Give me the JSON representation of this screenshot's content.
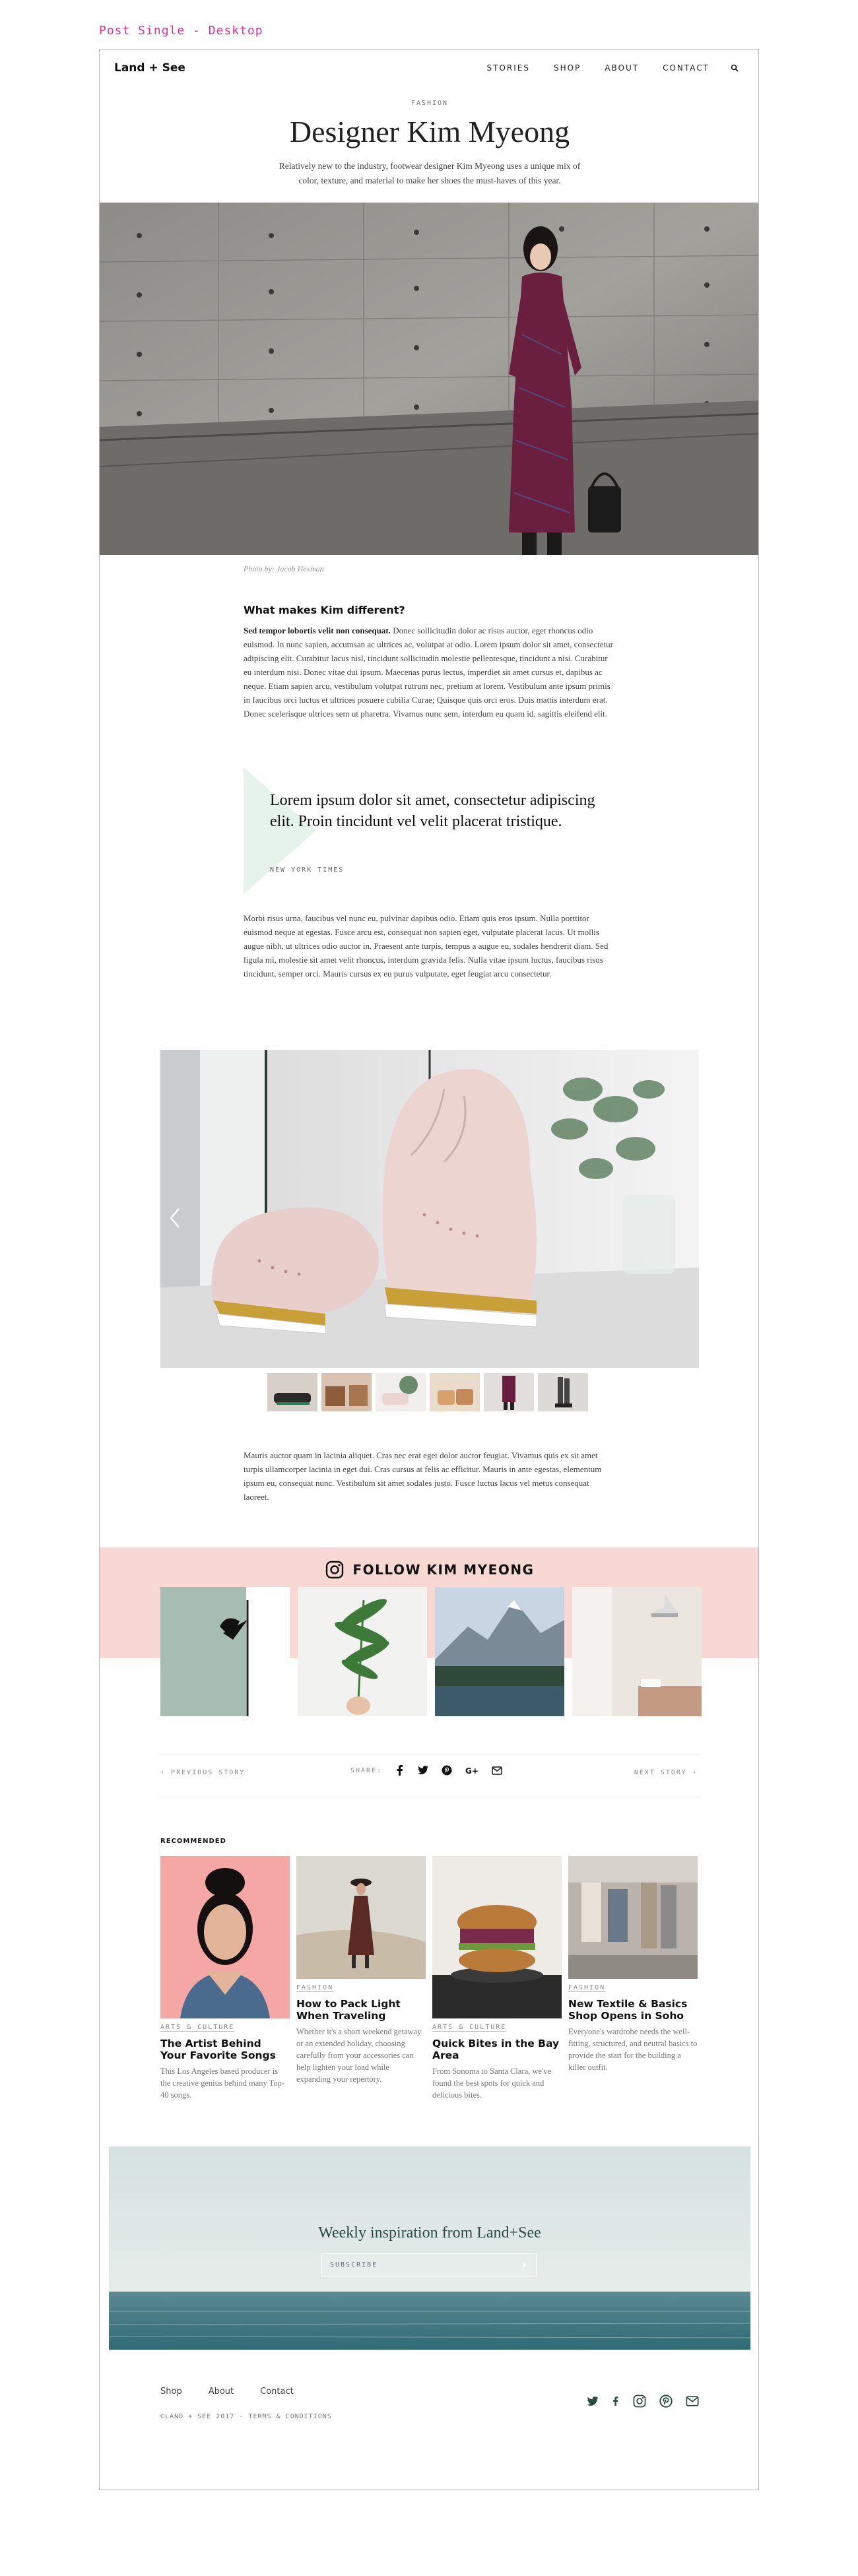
{
  "page_label": "Post Single - Desktop",
  "header": {
    "logo": "Land + See",
    "nav": [
      "STORIES",
      "SHOP",
      "ABOUT",
      "CONTACT"
    ]
  },
  "article": {
    "category": "FASHION",
    "title": "Designer Kim Myeong",
    "subtitle": "Relatively new to the industry, footwear designer Kim Myeong uses a unique mix of color, texture, and material to make her shoes the must-haves of this year.",
    "hero_caption": "Photo by: Jacob Hexman",
    "heading": "What makes Kim different?",
    "para1_lead": "Sed tempor lobortis velit non consequat.",
    "para1_rest": " Donec sollicitudin dolor ac risus auctor, eget rhoncus odio euismod. In nunc sapien, accumsan ac ultrices ac, volutpat at odio. Lorem ipsum dolor sit amet, consectetur adipiscing elit. Curabitur lacus nisl, tincidunt sollicitudin molestie pellentesque, tincidunt a nisi. Curabitur eu interdum nisi. Donec vitae dui ipsum. Maecenas purus lectus, imperdiet sit amet cursus et, dapibus ac neque. Etiam sapien arcu, vestibulum volutpat rutrum nec, pretium at lorem. Vestibulum ante ipsum primis in faucibus orci luctus et ultrices posuere cubilia Curae; Quisque quis orci eros. Duis mattis interdum erat. Donec scelerisque ultrices sem ut pharetra. Vivamus nunc sem, interdum eu quam id, sagittis eleifend elit.",
    "quote": "Lorem ipsum dolor sit amet, consectetur adipiscing elit. Proin tincidunt vel velit placerat tristique.",
    "quote_source": "NEW YORK TIMES",
    "para2": "Morbi risus urna, faucibus vel nunc eu, pulvinar dapibus odio. Etiam quis eros ipsum. Nulla porttitor euismod neque at egestas. Fusce arcu est, consequat non sapien eget, vulputate placerat lacus. Ut mollis augue nibh, ut ultrices odio auctor in. Praesent ante turpis, tempus a augue eu, sodales hendrerit diam. Sed ligula mi, molestie sit amet velit rhoncus, interdum gravida felis. Nulla vitae ipsum luctus, faucibus risus tincidunt, semper orci. Mauris cursus ex eu purus vulputate, eget feugiat arcu consectetur.",
    "para3": "Mauris auctor quam in lacinia aliquet. Cras nec erat eget dolor auctor feugiat. Vivamus quis ex sit amet turpis ullamcorper lacinia in eget dui. Cras cursus at felis ac efficitur. Mauris in ante egestas, elementum ipsum eu, consequat nunc. Vestibulum sit amet sodales justo. Fusce luctus lacus vel metus consequat laoreet."
  },
  "follow": {
    "title": "FOLLOW KIM MYEONG"
  },
  "share_bar": {
    "prev": "PREVIOUS STORY",
    "share_label": "SHARE:",
    "next": "NEXT STORY"
  },
  "recommended": {
    "label": "RECOMMENDED",
    "cards": [
      {
        "category": "ARTS & CULTURE",
        "title": "The Artist Behind Your Favorite Songs",
        "body": "This Los Angeles based producer is the creative genius behind many Top-40 songs."
      },
      {
        "category": "FASHION",
        "title": "How to Pack Light When Traveling",
        "body": "Whether it's a short weekend getaway or an extended holiday, choosing carefully from your accessories can help lighten your load while expanding your repertory."
      },
      {
        "category": "ARTS & CULTURE",
        "title": "Quick Bites in the Bay Area",
        "body": "From Sonoma to Santa Clara, we've found the best spots for quick and delicious bites."
      },
      {
        "category": "FASHION",
        "title": "New Textile & Basics Shop Opens in Soho",
        "body": "Everyone's wardrobe needs the well-fitting, structured, and neutral basics to provide the start for the building a killer outfit."
      }
    ]
  },
  "newsletter": {
    "title": "Weekly inspiration from Land+See",
    "placeholder": "SUBSCRIBE"
  },
  "footer": {
    "links": [
      "Shop",
      "About",
      "Contact"
    ],
    "copyright": "©LAND + SEE 2017 - TERMS & CONDITIONS"
  }
}
